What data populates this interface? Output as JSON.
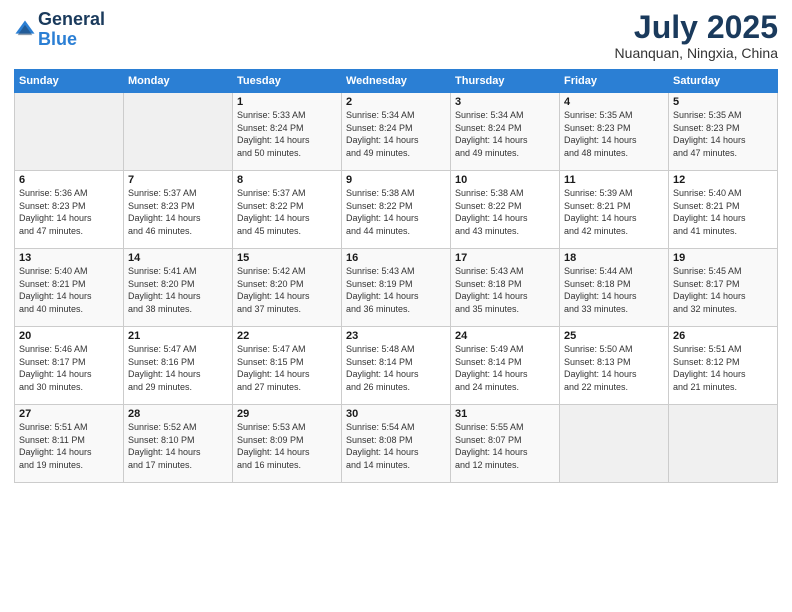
{
  "header": {
    "logo_general": "General",
    "logo_blue": "Blue",
    "month_title": "July 2025",
    "location": "Nuanquan, Ningxia, China"
  },
  "calendar": {
    "days_of_week": [
      "Sunday",
      "Monday",
      "Tuesday",
      "Wednesday",
      "Thursday",
      "Friday",
      "Saturday"
    ],
    "weeks": [
      [
        {
          "day": "",
          "info": ""
        },
        {
          "day": "",
          "info": ""
        },
        {
          "day": "1",
          "info": "Sunrise: 5:33 AM\nSunset: 8:24 PM\nDaylight: 14 hours\nand 50 minutes."
        },
        {
          "day": "2",
          "info": "Sunrise: 5:34 AM\nSunset: 8:24 PM\nDaylight: 14 hours\nand 49 minutes."
        },
        {
          "day": "3",
          "info": "Sunrise: 5:34 AM\nSunset: 8:24 PM\nDaylight: 14 hours\nand 49 minutes."
        },
        {
          "day": "4",
          "info": "Sunrise: 5:35 AM\nSunset: 8:23 PM\nDaylight: 14 hours\nand 48 minutes."
        },
        {
          "day": "5",
          "info": "Sunrise: 5:35 AM\nSunset: 8:23 PM\nDaylight: 14 hours\nand 47 minutes."
        }
      ],
      [
        {
          "day": "6",
          "info": "Sunrise: 5:36 AM\nSunset: 8:23 PM\nDaylight: 14 hours\nand 47 minutes."
        },
        {
          "day": "7",
          "info": "Sunrise: 5:37 AM\nSunset: 8:23 PM\nDaylight: 14 hours\nand 46 minutes."
        },
        {
          "day": "8",
          "info": "Sunrise: 5:37 AM\nSunset: 8:22 PM\nDaylight: 14 hours\nand 45 minutes."
        },
        {
          "day": "9",
          "info": "Sunrise: 5:38 AM\nSunset: 8:22 PM\nDaylight: 14 hours\nand 44 minutes."
        },
        {
          "day": "10",
          "info": "Sunrise: 5:38 AM\nSunset: 8:22 PM\nDaylight: 14 hours\nand 43 minutes."
        },
        {
          "day": "11",
          "info": "Sunrise: 5:39 AM\nSunset: 8:21 PM\nDaylight: 14 hours\nand 42 minutes."
        },
        {
          "day": "12",
          "info": "Sunrise: 5:40 AM\nSunset: 8:21 PM\nDaylight: 14 hours\nand 41 minutes."
        }
      ],
      [
        {
          "day": "13",
          "info": "Sunrise: 5:40 AM\nSunset: 8:21 PM\nDaylight: 14 hours\nand 40 minutes."
        },
        {
          "day": "14",
          "info": "Sunrise: 5:41 AM\nSunset: 8:20 PM\nDaylight: 14 hours\nand 38 minutes."
        },
        {
          "day": "15",
          "info": "Sunrise: 5:42 AM\nSunset: 8:20 PM\nDaylight: 14 hours\nand 37 minutes."
        },
        {
          "day": "16",
          "info": "Sunrise: 5:43 AM\nSunset: 8:19 PM\nDaylight: 14 hours\nand 36 minutes."
        },
        {
          "day": "17",
          "info": "Sunrise: 5:43 AM\nSunset: 8:18 PM\nDaylight: 14 hours\nand 35 minutes."
        },
        {
          "day": "18",
          "info": "Sunrise: 5:44 AM\nSunset: 8:18 PM\nDaylight: 14 hours\nand 33 minutes."
        },
        {
          "day": "19",
          "info": "Sunrise: 5:45 AM\nSunset: 8:17 PM\nDaylight: 14 hours\nand 32 minutes."
        }
      ],
      [
        {
          "day": "20",
          "info": "Sunrise: 5:46 AM\nSunset: 8:17 PM\nDaylight: 14 hours\nand 30 minutes."
        },
        {
          "day": "21",
          "info": "Sunrise: 5:47 AM\nSunset: 8:16 PM\nDaylight: 14 hours\nand 29 minutes."
        },
        {
          "day": "22",
          "info": "Sunrise: 5:47 AM\nSunset: 8:15 PM\nDaylight: 14 hours\nand 27 minutes."
        },
        {
          "day": "23",
          "info": "Sunrise: 5:48 AM\nSunset: 8:14 PM\nDaylight: 14 hours\nand 26 minutes."
        },
        {
          "day": "24",
          "info": "Sunrise: 5:49 AM\nSunset: 8:14 PM\nDaylight: 14 hours\nand 24 minutes."
        },
        {
          "day": "25",
          "info": "Sunrise: 5:50 AM\nSunset: 8:13 PM\nDaylight: 14 hours\nand 22 minutes."
        },
        {
          "day": "26",
          "info": "Sunrise: 5:51 AM\nSunset: 8:12 PM\nDaylight: 14 hours\nand 21 minutes."
        }
      ],
      [
        {
          "day": "27",
          "info": "Sunrise: 5:51 AM\nSunset: 8:11 PM\nDaylight: 14 hours\nand 19 minutes."
        },
        {
          "day": "28",
          "info": "Sunrise: 5:52 AM\nSunset: 8:10 PM\nDaylight: 14 hours\nand 17 minutes."
        },
        {
          "day": "29",
          "info": "Sunrise: 5:53 AM\nSunset: 8:09 PM\nDaylight: 14 hours\nand 16 minutes."
        },
        {
          "day": "30",
          "info": "Sunrise: 5:54 AM\nSunset: 8:08 PM\nDaylight: 14 hours\nand 14 minutes."
        },
        {
          "day": "31",
          "info": "Sunrise: 5:55 AM\nSunset: 8:07 PM\nDaylight: 14 hours\nand 12 minutes."
        },
        {
          "day": "",
          "info": ""
        },
        {
          "day": "",
          "info": ""
        }
      ]
    ]
  }
}
